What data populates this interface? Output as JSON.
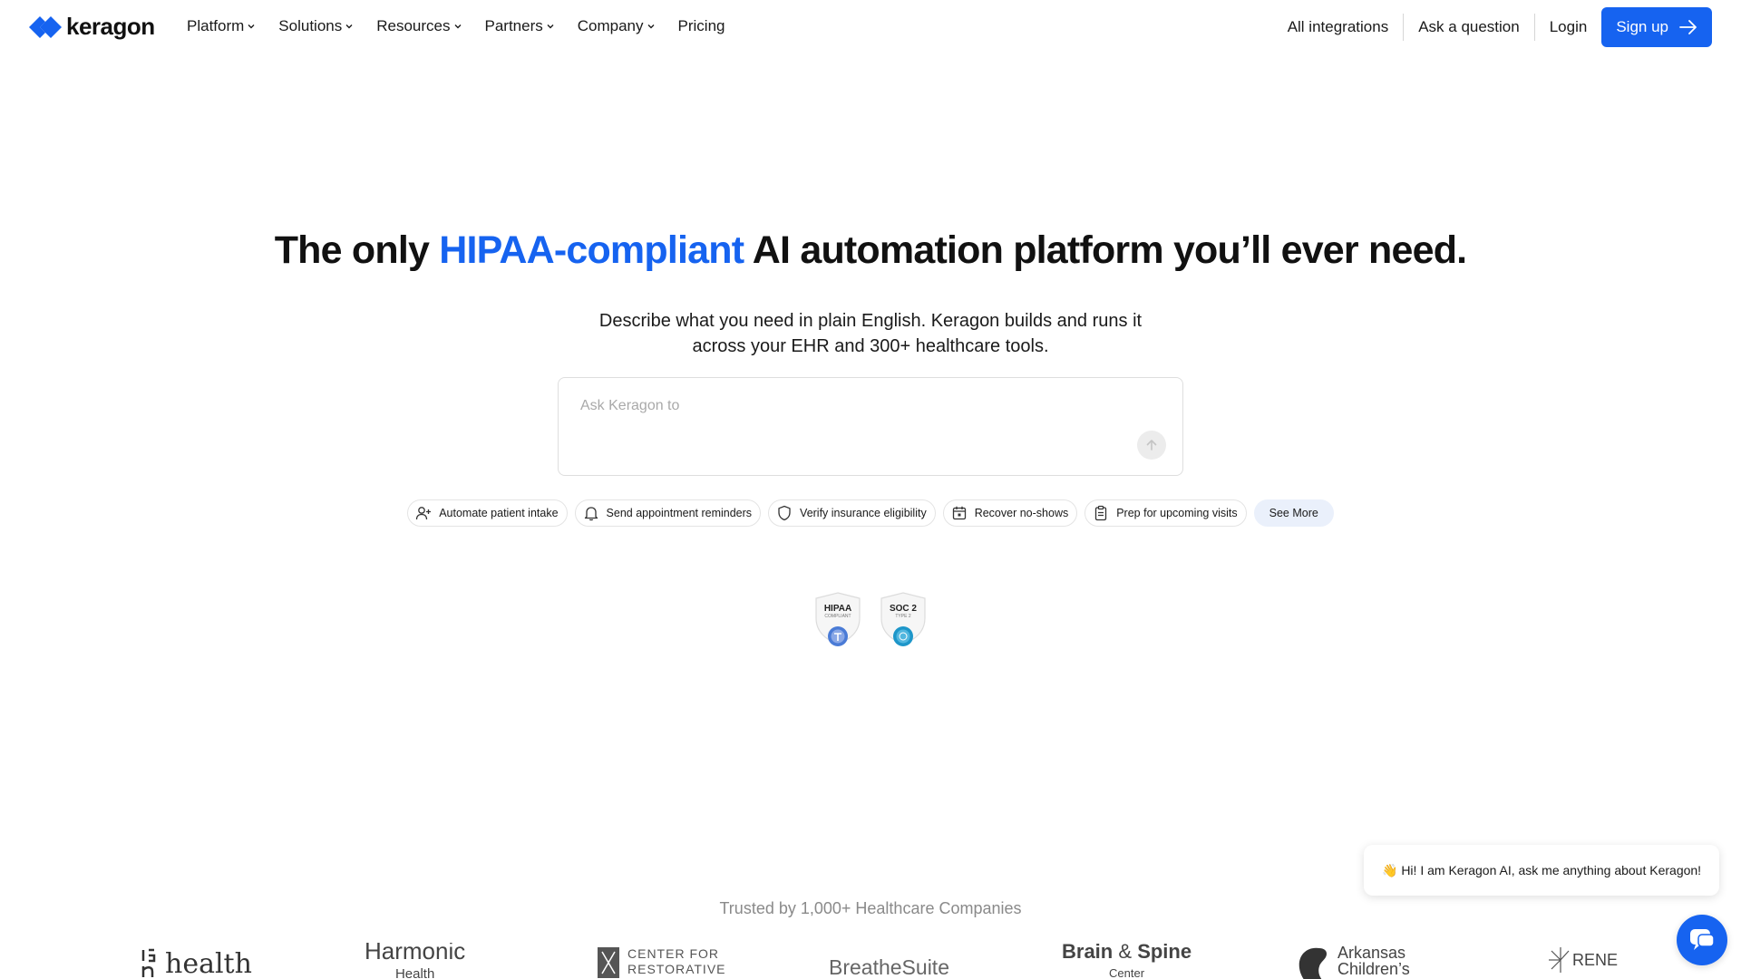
{
  "brand": {
    "name": "keragon",
    "accent": "#1663f0"
  },
  "nav": {
    "menu": [
      {
        "label": "Platform",
        "has_dropdown": true
      },
      {
        "label": "Solutions",
        "has_dropdown": true
      },
      {
        "label": "Resources",
        "has_dropdown": true
      },
      {
        "label": "Partners",
        "has_dropdown": true
      },
      {
        "label": "Company",
        "has_dropdown": true
      },
      {
        "label": "Pricing",
        "has_dropdown": false
      }
    ],
    "all_integrations": "All integrations",
    "ask_question": "Ask a question",
    "login": "Login",
    "signup": "Sign up"
  },
  "hero": {
    "headline_pre": "The only ",
    "headline_highlight": "HIPAA-compliant",
    "headline_post": " AI automation platform you’ll ever need.",
    "subhead_line1": "Describe what you need in plain English. Keragon builds and runs it",
    "subhead_line2": "across your EHR and 300+ healthcare tools.",
    "prompt_placeholder": "Ask Keragon to",
    "prompt_value": ""
  },
  "suggestions": [
    {
      "label": "Automate patient intake",
      "icon": "user-plus-icon"
    },
    {
      "label": "Send appointment reminders",
      "icon": "bell-icon"
    },
    {
      "label": "Verify insurance eligibility",
      "icon": "shield-icon"
    },
    {
      "label": "Recover no-shows",
      "icon": "calendar-icon"
    },
    {
      "label": "Prep for upcoming visits",
      "icon": "clipboard-icon"
    }
  ],
  "see_more": "See More",
  "badges": [
    {
      "title": "HIPAA",
      "sub": "COMPLIANT"
    },
    {
      "title": "SOC 2",
      "sub": "TYPE 2"
    }
  ],
  "trusted": {
    "heading": "Trusted by 1,000+ Healthcare Companies",
    "logos": [
      "health",
      "Harmonic",
      "Health",
      "CENTER FOR",
      "RESTORATIVE",
      "BreatheSuite",
      "Brain",
      "Spine",
      "Center",
      "Arkansas",
      "Children’s",
      "RENE"
    ]
  },
  "chat": {
    "message": "👋 Hi! I am Keragon AI, ask me anything about Keragon!"
  }
}
